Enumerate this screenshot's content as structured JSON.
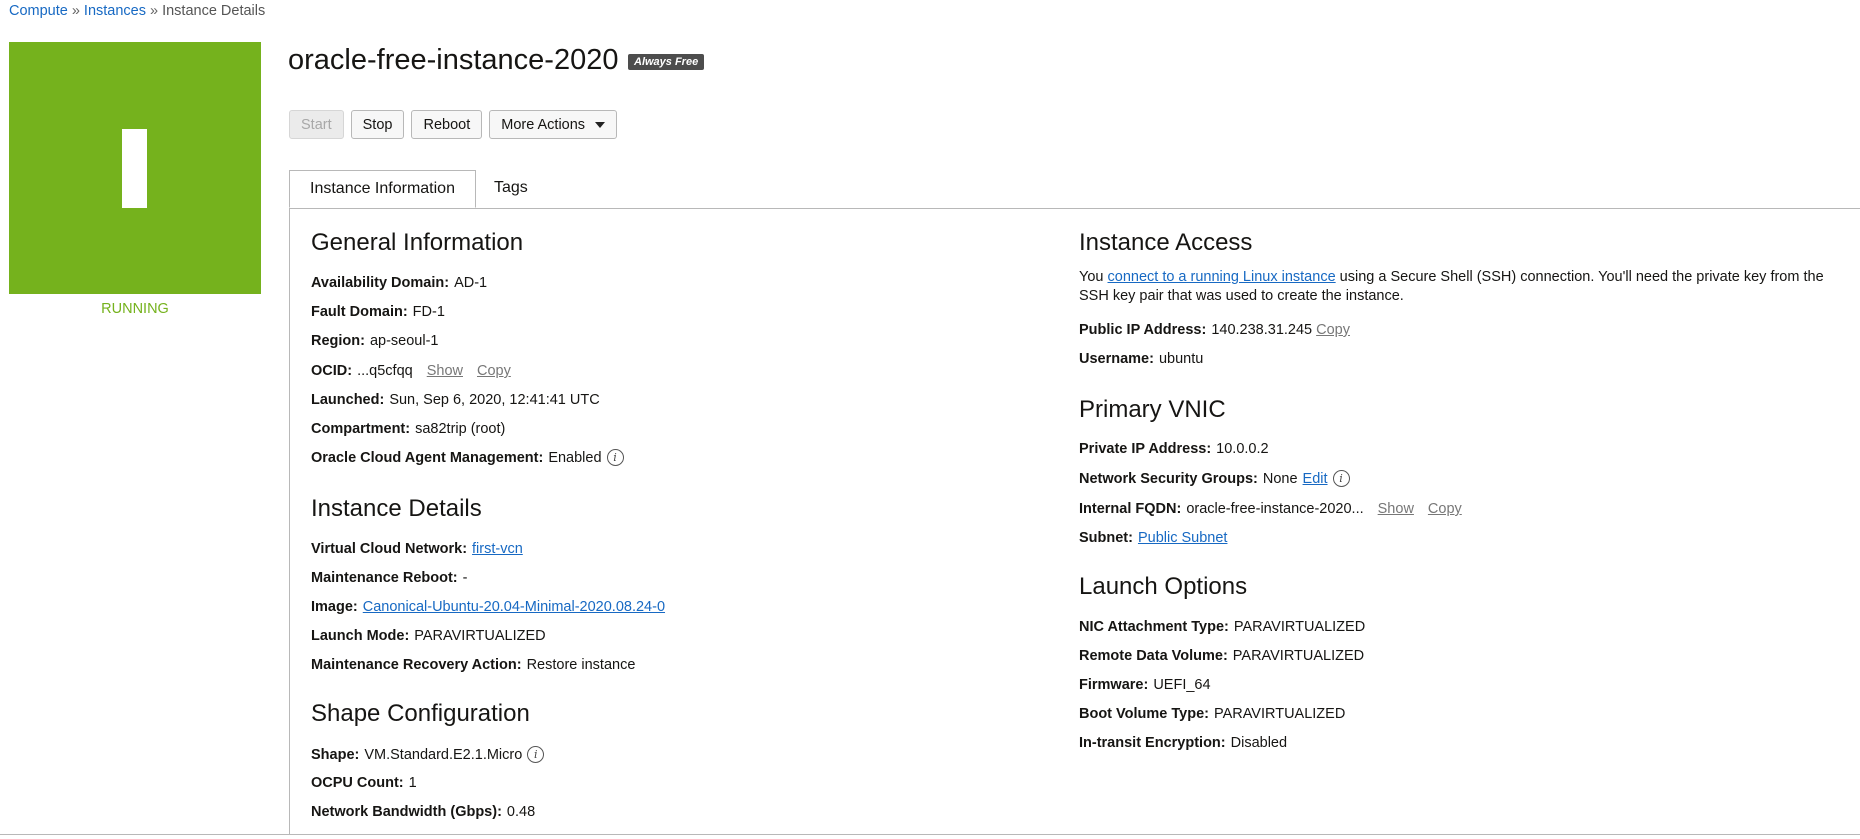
{
  "breadcrumb": {
    "compute": "Compute",
    "instances": "Instances",
    "current": "Instance Details",
    "sep": "»"
  },
  "status": {
    "label": "RUNNING",
    "color": "#75b21d"
  },
  "instance": {
    "name": "oracle-free-instance-2020",
    "badge": "Always Free"
  },
  "actions": {
    "start": "Start",
    "stop": "Stop",
    "reboot": "Reboot",
    "more": "More Actions"
  },
  "tabs": {
    "info": "Instance Information",
    "tags": "Tags"
  },
  "general": {
    "title": "General Information",
    "availability_domain": {
      "label": "Availability Domain:",
      "value": "AD-1"
    },
    "fault_domain": {
      "label": "Fault Domain:",
      "value": "FD-1"
    },
    "region": {
      "label": "Region:",
      "value": "ap-seoul-1"
    },
    "ocid": {
      "label": "OCID:",
      "value": "...q5cfqq",
      "show": "Show",
      "copy": "Copy"
    },
    "launched": {
      "label": "Launched:",
      "value": "Sun, Sep 6, 2020, 12:41:41 UTC"
    },
    "compartment": {
      "label": "Compartment:",
      "value": "sa82trip (root)"
    },
    "agent": {
      "label": "Oracle Cloud Agent Management:",
      "value": "Enabled"
    }
  },
  "details": {
    "title": "Instance Details",
    "vcn": {
      "label": "Virtual Cloud Network:",
      "value": "first-vcn"
    },
    "maintenance_reboot": {
      "label": "Maintenance Reboot:",
      "value": "-"
    },
    "image": {
      "label": "Image:",
      "value": "Canonical-Ubuntu-20.04-Minimal-2020.08.24-0"
    },
    "launch_mode": {
      "label": "Launch Mode:",
      "value": "PARAVIRTUALIZED"
    },
    "recovery": {
      "label": "Maintenance Recovery Action:",
      "value": "Restore instance"
    }
  },
  "shape": {
    "title": "Shape Configuration",
    "shape": {
      "label": "Shape:",
      "value": "VM.Standard.E2.1.Micro"
    },
    "ocpu": {
      "label": "OCPU Count:",
      "value": "1"
    },
    "bandwidth": {
      "label": "Network Bandwidth (Gbps):",
      "value": "0.48"
    }
  },
  "access": {
    "title": "Instance Access",
    "desc_prefix": "You",
    "desc_link": "connect to a running Linux instance",
    "desc_suffix": "using a Secure Shell (SSH) connection. You'll need the private key from the SSH key pair that was used to create the instance.",
    "public_ip": {
      "label": "Public IP Address:",
      "value": "140.238.31.245",
      "copy": "Copy"
    },
    "username": {
      "label": "Username:",
      "value": "ubuntu"
    }
  },
  "vnic": {
    "title": "Primary VNIC",
    "private_ip": {
      "label": "Private IP Address:",
      "value": "10.0.0.2"
    },
    "nsg": {
      "label": "Network Security Groups:",
      "value": "None",
      "edit": "Edit"
    },
    "fqdn": {
      "label": "Internal FQDN:",
      "value": "oracle-free-instance-2020...",
      "show": "Show",
      "copy": "Copy"
    },
    "subnet": {
      "label": "Subnet:",
      "value": "Public Subnet"
    }
  },
  "launch": {
    "title": "Launch Options",
    "nic": {
      "label": "NIC Attachment Type:",
      "value": "PARAVIRTUALIZED"
    },
    "remote": {
      "label": "Remote Data Volume:",
      "value": "PARAVIRTUALIZED"
    },
    "firmware": {
      "label": "Firmware:",
      "value": "UEFI_64"
    },
    "boot": {
      "label": "Boot Volume Type:",
      "value": "PARAVIRTUALIZED"
    },
    "encryption": {
      "label": "In-transit Encryption:",
      "value": "Disabled"
    }
  },
  "info_glyph": "i"
}
